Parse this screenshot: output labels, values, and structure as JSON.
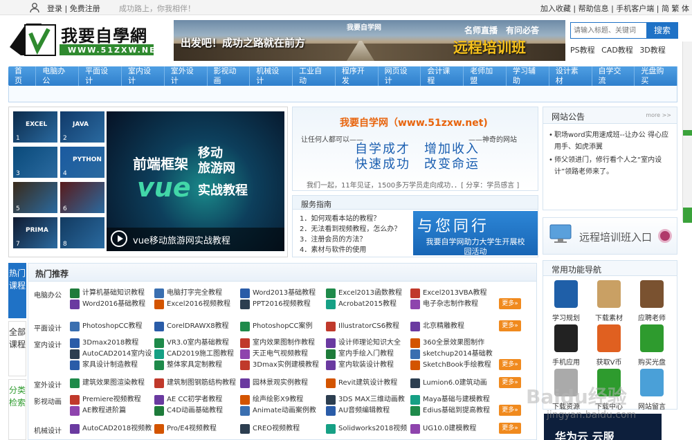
{
  "topbar": {
    "login": "登录 | 免费注册",
    "slogan": "成功路上，你我相伴！",
    "right": "加入收藏 | 帮助信息 | 手机客户端 | 简 繁 体"
  },
  "logo": {
    "title": "我要自學網",
    "url": "WWW.51ZXW.NET"
  },
  "banner": {
    "site": "我要自学网",
    "slogan": "出发吧！成功之路就在前方",
    "tag": "名师直播　有问必答",
    "title": "远程培训班"
  },
  "search": {
    "placeholder": "请输入标题、关键词",
    "button": "搜索"
  },
  "hotkeys": [
    "PS教程",
    "CAD教程",
    "3D教程"
  ],
  "nav": [
    "首页",
    "电脑办公",
    "平面设计",
    "室内设计",
    "室外设计",
    "影视动画",
    "机械设计",
    "工业自动",
    "程序开发",
    "网页设计",
    "会计课程",
    "老师加盟",
    "学习辅助",
    "设计素材",
    "自学交流",
    "光盘购买"
  ],
  "slider": {
    "big_line1": "前端框架",
    "big_line2a": "移动",
    "big_line2b": "旅游网",
    "big_vue": "vue",
    "big_line3": "实战教程",
    "caption": "vue移动旅游网实战教程",
    "thumb_nums": [
      "1",
      "2",
      "3",
      "4",
      "5",
      "6",
      "7",
      "8"
    ],
    "thumb_texts": [
      "EXCEL",
      "JAVA",
      "",
      "PYTHON",
      "",
      "",
      "PRIMA",
      ""
    ]
  },
  "intro": {
    "headline": "我要自学网（www.51zxw.net)",
    "left": "让任何人都可以——",
    "right": "——神奇的网站",
    "big1": "自学成才　增加收入",
    "big2": "快速成功　改变命运",
    "foot": "我们一起，11年见证，1500多万学员走向成功．．[ 分享：学员感言 ]"
  },
  "service": {
    "title": "服务指南",
    "items": [
      "1．如何观看本站的教程？",
      "2．无法看到视频教程，怎么办？",
      "3．注册会员的方法？",
      "4．素材与软件的使用"
    ],
    "promo_big": "与您同行",
    "promo_small": "我要自学网助力大学生开展校园活动"
  },
  "notice": {
    "title": "网站公告",
    "more": "more >>",
    "items": [
      "职场word实用速成班--让办公 得心应用手、如虎添翼",
      "师父领进门，修行看个人之“室内设计”领路老师来了。"
    ]
  },
  "train": {
    "label": "远程培训班入口"
  },
  "sidetabs": {
    "hot": "热门课程",
    "all": "全部课程",
    "cat": "分类检索"
  },
  "hot": {
    "title": "热门推荐",
    "more": "更多»",
    "rows": [
      {
        "cat": "电脑办公",
        "links": [
          "计算机基础知识教程",
          "电脑打字完全教程",
          "Word2013基础教程",
          "Excel2013函数教程",
          "Excel2013VBA教程",
          "Word2016基础教程",
          "Excel2016视频教程",
          "PPT2016视频教程",
          "Acrobat2015教程",
          "电子杂志制作教程"
        ]
      },
      {
        "cat": "平面设计",
        "links": [
          "PhotoshopCC教程",
          "CorelDRAWX8教程",
          "PhotoshopCC案例",
          "IllustratorCS6教程",
          "北京精雕教程"
        ]
      },
      {
        "cat": "室内设计",
        "links": [
          "3Dmax2018教程",
          "VR3.0室内基础教程",
          "室内效果图制作教程",
          "设计师理论知识大全",
          "360全景效果图制作",
          "AutoCAD2014室内设",
          "CAD2019施工图教程",
          "天正电气视频教程",
          "室内手绘入门教程",
          "sketchup2014基础教",
          "家具设计制造教程",
          "整体家具定制教程",
          "3Dmax实例建模教程",
          "室内软装设计教程",
          "SketchBook手绘教程"
        ]
      },
      {
        "cat": "室外设计",
        "links": [
          "建筑效果图渲染教程",
          "建筑制图钢筋结构教程",
          "园林景观实例教程",
          "Revit建筑设计教程",
          "Lumion6.0建筑动画"
        ]
      },
      {
        "cat": "影视动画",
        "links": [
          "Premiere视频教程",
          "AE CC初学者教程",
          "绘声绘影X9教程",
          "3DS MAX三维动画教",
          "Maya基础与建模教程",
          "AE教程进阶篇",
          "C4D动画基础教程",
          "Animate动画案例教",
          "AU音频编辑教程",
          "Edius基础到提高教程"
        ]
      },
      {
        "cat": "机械设计",
        "links": [
          "AutoCAD2018视频教",
          "Pro/E4视频教程",
          "CREO视频教程",
          "Solidworks2018视频",
          "UG10.0建模教程"
        ]
      }
    ]
  },
  "tools": {
    "title": "常用功能导航",
    "items": [
      "学习规划",
      "下载素材",
      "应聘老师",
      "手机应用",
      "获取V币",
      "购买光盘",
      "下载资源",
      "下载中心",
      "网站留言"
    ]
  },
  "ad": {
    "text": "华为云 云服"
  },
  "watermark": {
    "big": "Baidu经验",
    "small": "jingyan.baidu.com"
  }
}
